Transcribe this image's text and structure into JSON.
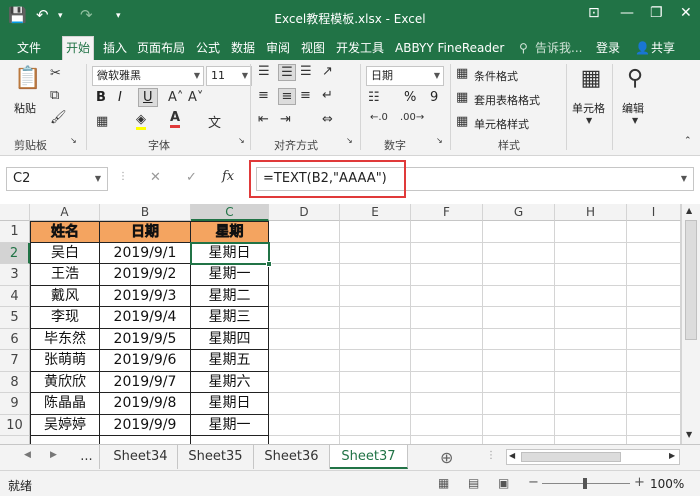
{
  "titlebar": {
    "title": "Excel教程模板.xlsx - Excel",
    "min": "—",
    "restore": "❐",
    "close": "✕",
    "ribbon_opts": "⊡"
  },
  "tabs": [
    "文件",
    "开始",
    "插入",
    "页面布局",
    "公式",
    "数据",
    "审阅",
    "视图",
    "开发工具",
    "ABBYY FineReader"
  ],
  "active_tab": "开始",
  "tell_me": "告诉我...",
  "login": "登录",
  "share": "共享",
  "ribbon": {
    "paste": "粘贴",
    "font_name": "微软雅黑",
    "font_size": "11",
    "bold": "B",
    "italic": "I",
    "underline": "U",
    "number_format": "日期",
    "percent": "%",
    "comma": "9",
    "conditional_format": "条件格式",
    "table_format": "套用表格格式",
    "cell_style": "单元格样式",
    "cells": "单元格",
    "edit": "编辑",
    "groups": {
      "clipboard": "剪贴板",
      "font": "字体",
      "align": "对齐方式",
      "number": "数字",
      "style": "样式"
    }
  },
  "formula_bar": {
    "name_box": "C2",
    "fx": "fx",
    "cancel": "✕",
    "enter": "✓",
    "formula": "=TEXT(B2,\"AAAA\")"
  },
  "grid": {
    "columns": [
      "A",
      "B",
      "C",
      "D",
      "E",
      "F",
      "G",
      "H",
      "I"
    ],
    "row_numbers": [
      "1",
      "2",
      "3",
      "4",
      "5",
      "6",
      "7",
      "8",
      "9",
      "10"
    ],
    "header_row": [
      "姓名",
      "日期",
      "星期"
    ],
    "rows": [
      [
        "吴白",
        "2019/9/1",
        "星期日"
      ],
      [
        "王浩",
        "2019/9/2",
        "星期一"
      ],
      [
        "戴风",
        "2019/9/3",
        "星期二"
      ],
      [
        "李现",
        "2019/9/4",
        "星期三"
      ],
      [
        "毕东然",
        "2019/9/5",
        "星期四"
      ],
      [
        "张萌萌",
        "2019/9/6",
        "星期五"
      ],
      [
        "黄欣欣",
        "2019/9/7",
        "星期六"
      ],
      [
        "陈晶晶",
        "2019/9/8",
        "星期日"
      ],
      [
        "吴婷婷",
        "2019/9/9",
        "星期一"
      ]
    ],
    "header_fill": "#f4a460"
  },
  "sheets": {
    "more": "...",
    "names": [
      "Sheet34",
      "Sheet35",
      "Sheet36",
      "Sheet37"
    ],
    "active": "Sheet37",
    "add": "⊕"
  },
  "status": {
    "ready": "就绪",
    "zoom": "100%",
    "minus": "−",
    "plus": "+"
  },
  "colors": {
    "excel_green": "#217346",
    "highlight_red": "#e03a3a"
  }
}
